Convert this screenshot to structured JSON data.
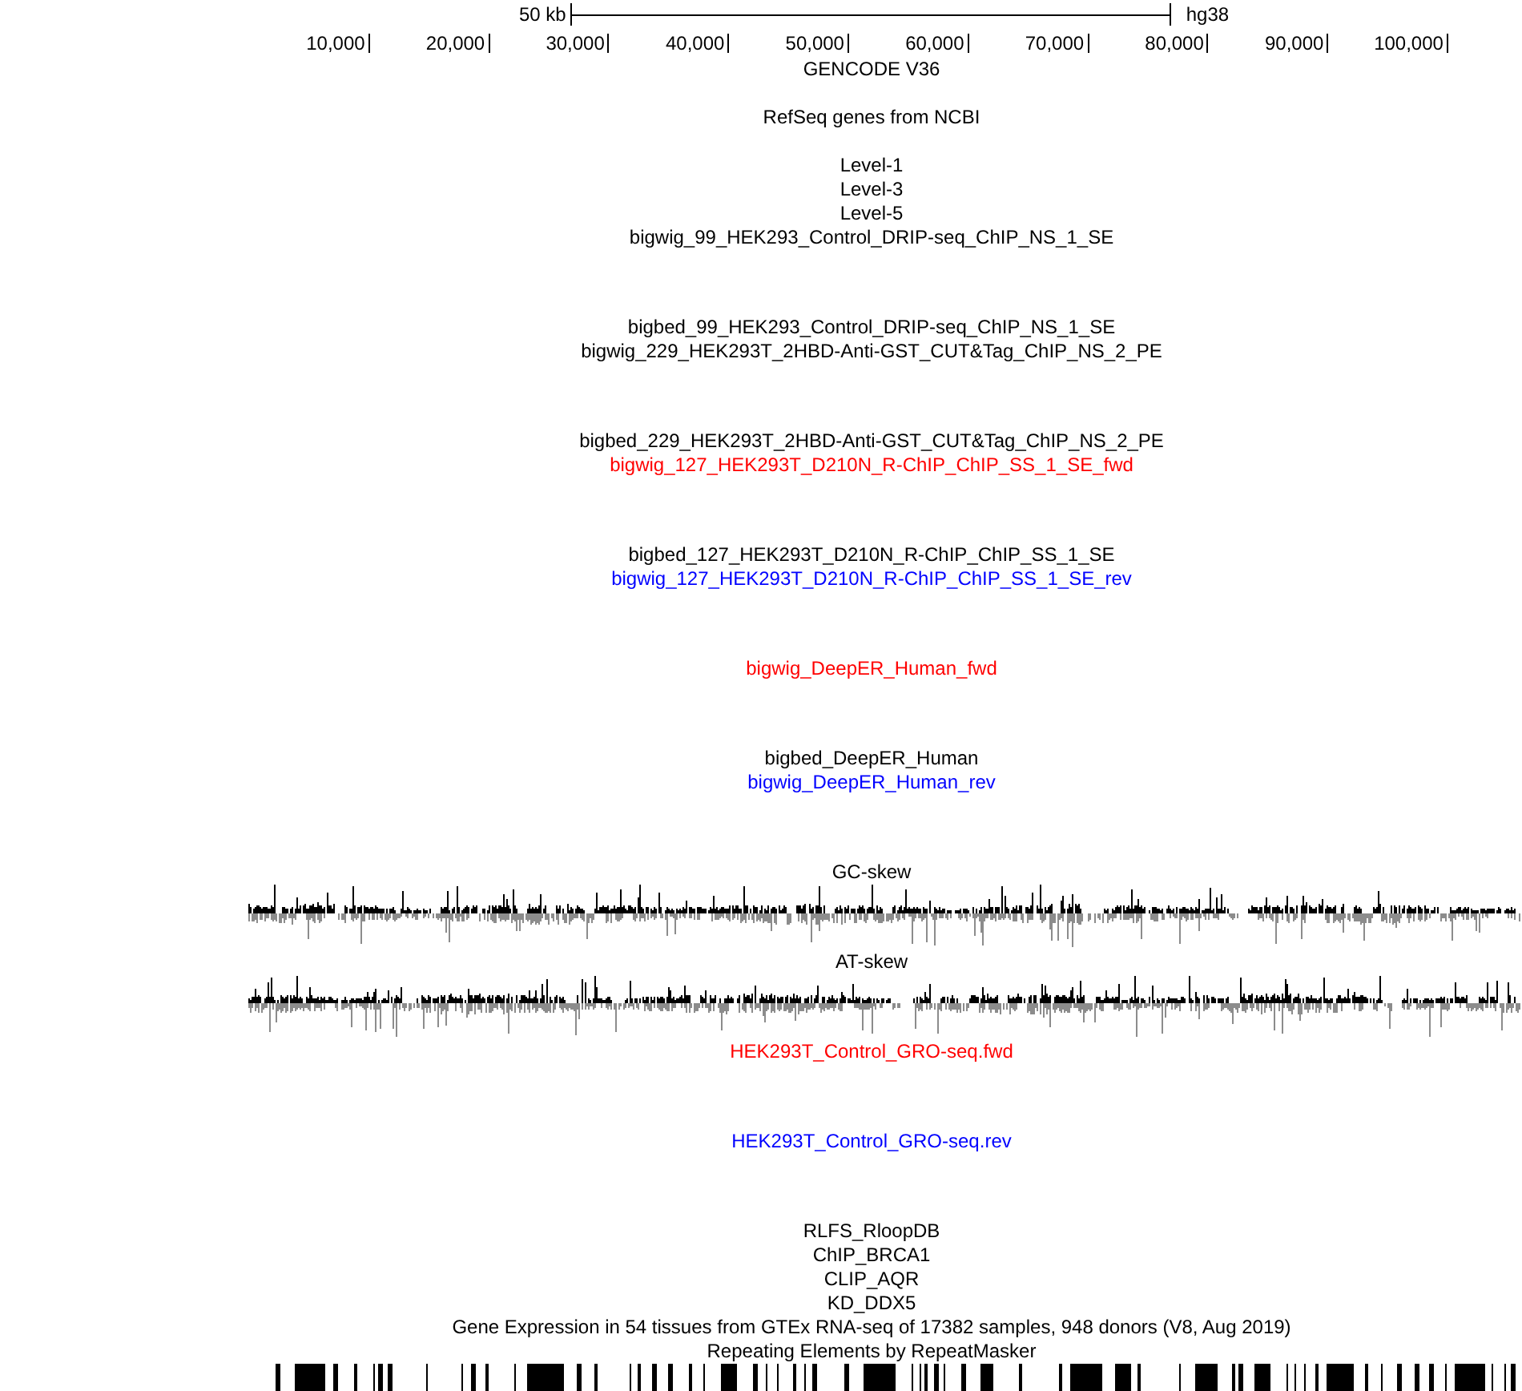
{
  "scale_bar": {
    "length": "50 kb",
    "assembly": "hg38"
  },
  "ruler": {
    "ticks": [
      "10,000",
      "20,000",
      "30,000",
      "40,000",
      "50,000",
      "60,000",
      "70,000",
      "80,000",
      "90,000",
      "100,000"
    ]
  },
  "tracks": [
    {
      "kind": "genes",
      "label": "GENCODE V36",
      "color": "#000000"
    },
    {
      "kind": "genes",
      "label": "RefSeq genes from NCBI",
      "color": "#000000"
    },
    {
      "kind": "bed",
      "label": "Level-1",
      "color": "#000000"
    },
    {
      "kind": "bed",
      "label": "Level-3",
      "color": "#000000"
    },
    {
      "kind": "bed",
      "label": "Level-5",
      "color": "#000000"
    },
    {
      "kind": "bigwig",
      "label": "bigwig_99_HEK293_Control_DRIP-seq_ChIP_NS_1_SE",
      "color": "#000000"
    },
    {
      "kind": "bed",
      "label": "bigbed_99_HEK293_Control_DRIP-seq_ChIP_NS_1_SE",
      "color": "#000000"
    },
    {
      "kind": "bigwig",
      "label": "bigwig_229_HEK293T_2HBD-Anti-GST_CUT&Tag_ChIP_NS_2_PE",
      "color": "#000000"
    },
    {
      "kind": "bed",
      "label": "bigbed_229_HEK293T_2HBD-Anti-GST_CUT&Tag_ChIP_NS_2_PE",
      "color": "#000000"
    },
    {
      "kind": "bigwig",
      "label": "bigwig_127_HEK293T_D210N_R-ChIP_ChIP_SS_1_SE_fwd",
      "color": "#ff0000"
    },
    {
      "kind": "bed",
      "label": "bigbed_127_HEK293T_D210N_R-ChIP_ChIP_SS_1_SE",
      "color": "#000000"
    },
    {
      "kind": "bigwig",
      "label": "bigwig_127_HEK293T_D210N_R-ChIP_ChIP_SS_1_SE_rev",
      "color": "#0000ff"
    },
    {
      "kind": "bigwig",
      "label": "bigwig_DeepER_Human_fwd",
      "color": "#ff0000"
    },
    {
      "kind": "bed",
      "label": "bigbed_DeepER_Human",
      "color": "#000000"
    },
    {
      "kind": "bigwig",
      "label": "bigwig_DeepER_Human_rev",
      "color": "#0000ff"
    },
    {
      "kind": "skew",
      "label": "GC-skew",
      "color": "#000000"
    },
    {
      "kind": "skew",
      "label": "AT-skew",
      "color": "#000000"
    },
    {
      "kind": "bigwig",
      "label": "HEK293T_Control_GRO-seq.fwd",
      "color": "#ff0000"
    },
    {
      "kind": "bigwig",
      "label": "HEK293T_Control_GRO-seq.rev",
      "color": "#0000ff"
    },
    {
      "kind": "bed",
      "label": "RLFS_RloopDB",
      "color": "#000000"
    },
    {
      "kind": "bed",
      "label": "ChIP_BRCA1",
      "color": "#000000"
    },
    {
      "kind": "bed",
      "label": "CLIP_AQR",
      "color": "#000000"
    },
    {
      "kind": "bed",
      "label": "KD_DDX5",
      "color": "#000000"
    },
    {
      "kind": "bed",
      "label": "Gene Expression in 54 tissues from GTEx RNA-seq of 17382 samples, 948 donors (V8, Aug 2019)",
      "color": "#000000"
    },
    {
      "kind": "repeats",
      "label": "Repeating Elements by RepeatMasker",
      "color": "#000000"
    }
  ]
}
